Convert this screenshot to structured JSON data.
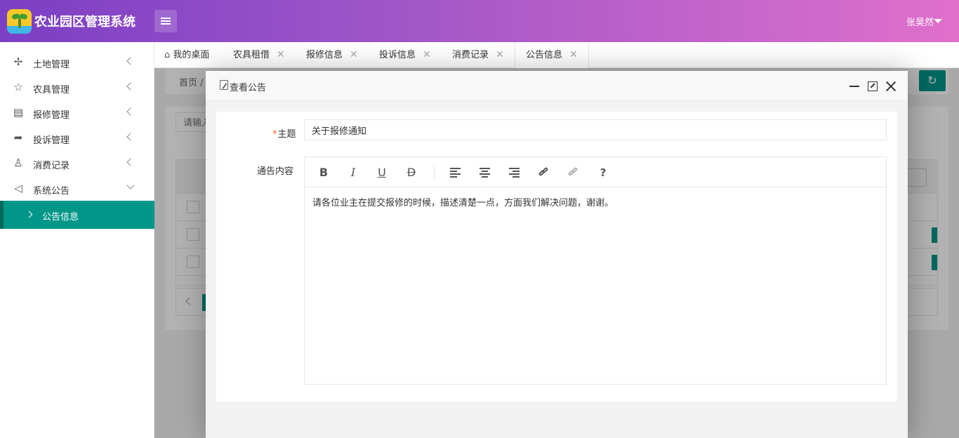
{
  "app": {
    "title": "农业园区管理系统",
    "user": "张昊然"
  },
  "sidebar": {
    "items": [
      {
        "label": "土地管理",
        "icon": "clover-icon"
      },
      {
        "label": "农具管理",
        "icon": "pin-icon"
      },
      {
        "label": "报修管理",
        "icon": "clipboard-icon"
      },
      {
        "label": "投诉管理",
        "icon": "share-icon"
      },
      {
        "label": "消费记录",
        "icon": "user-icon"
      },
      {
        "label": "系统公告",
        "icon": "speaker-icon"
      }
    ],
    "sub_item": {
      "label": "公告信息"
    }
  },
  "tabs": [
    {
      "label": "我的桌面"
    },
    {
      "label": "农具租借"
    },
    {
      "label": "报修信息"
    },
    {
      "label": "投诉信息"
    },
    {
      "label": "消费记录"
    },
    {
      "label": "公告信息"
    }
  ],
  "tab_close": "✕",
  "breadcrumb": {
    "text": "首页 /"
  },
  "search": {
    "placeholder": "请输入"
  },
  "modal": {
    "title": "查看公告",
    "subject_label": "主题",
    "subject_required": "*",
    "subject_value": "关于报修通知",
    "content_label": "通告内容",
    "content_text": "请各位业主在提交报修的时候，描述清楚一点，方面我们解决问题，谢谢。",
    "toolbar": {
      "bold": "B",
      "italic": "I",
      "underline": "U",
      "strike": "D",
      "help": "?"
    }
  },
  "colors": {
    "accent": "#009688",
    "header_start": "#7b3fc4",
    "header_end": "#e070cc"
  }
}
